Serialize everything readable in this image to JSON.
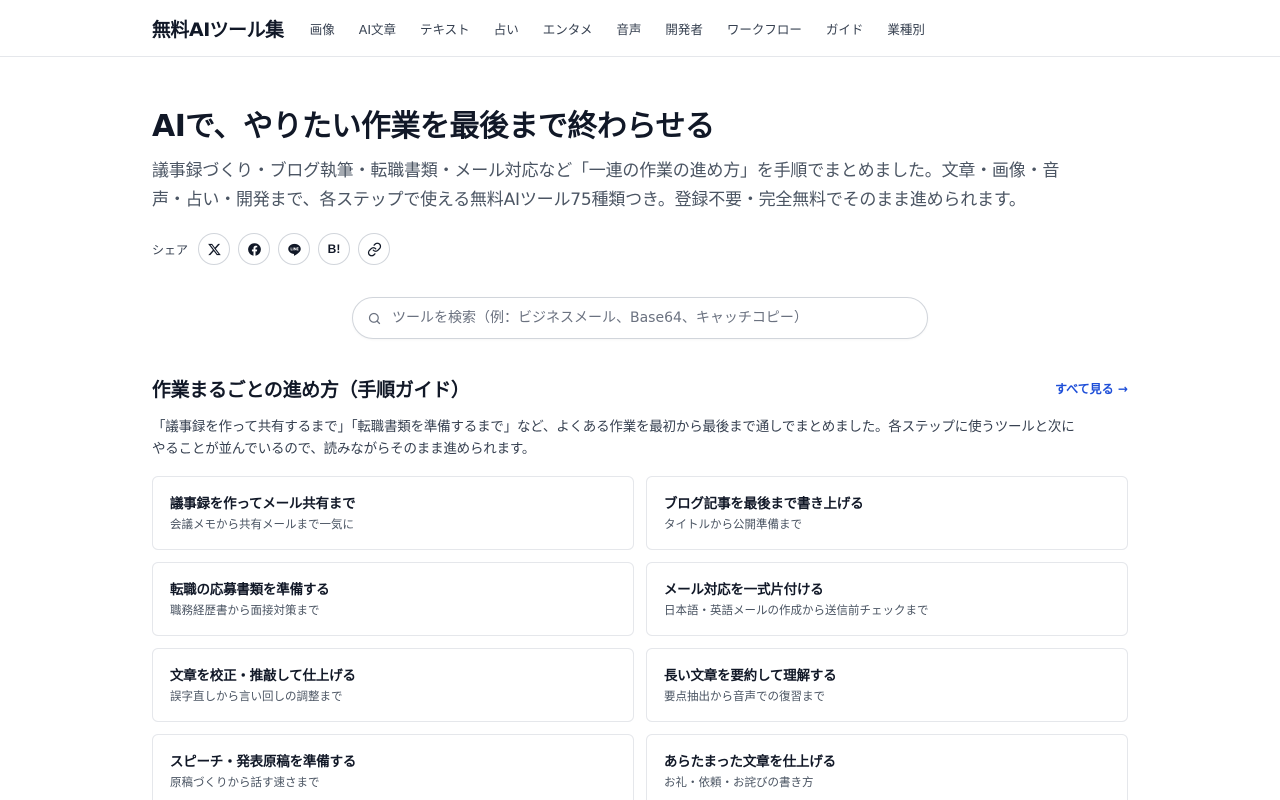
{
  "header": {
    "logo": "無料AIツール集",
    "nav": [
      "画像",
      "AI文章",
      "テキスト",
      "占い",
      "エンタメ",
      "音声",
      "開発者",
      "ワークフロー",
      "ガイド",
      "業種別"
    ]
  },
  "hero": {
    "title": "AIで、やりたい作業を最後まで終わらせる",
    "description_line1": "議事録づくり・ブログ執筆・転職書類・メール対応など「一連の作業の進め方」を手順でまとめました。文章・画像・音",
    "description_line2": "声・占い・開発まで、各ステップで使える無料AIツール75種類つき。登録不要・完全無料でそのまま進められます。"
  },
  "share": {
    "label": "シェア",
    "buttons": [
      {
        "icon": "x-icon"
      },
      {
        "icon": "facebook-icon"
      },
      {
        "icon": "line-icon"
      },
      {
        "icon": "hatena-icon",
        "text": "B!"
      },
      {
        "icon": "link-icon"
      }
    ]
  },
  "search": {
    "placeholder": "ツールを検索（例：ビジネスメール、Base64、キャッチコピー）",
    "icon": "search-icon"
  },
  "section": {
    "title": "作業まるごとの進め方（手順ガイド）",
    "see_all": "すべて見る →",
    "description_line1": "「議事録を作って共有するまで」「転職書類を準備するまで」など、よくある作業を最初から最後まで通しでまとめました。各ステップに使うツールと次に",
    "description_line2": "やることが並んでいるので、読みながらそのまま進められます。",
    "cards": [
      {
        "title": "議事録を作ってメール共有まで",
        "subtitle": "会議メモから共有メールまで一気に"
      },
      {
        "title": "ブログ記事を最後まで書き上げる",
        "subtitle": "タイトルから公開準備まで"
      },
      {
        "title": "転職の応募書類を準備する",
        "subtitle": "職務経歴書から面接対策まで"
      },
      {
        "title": "メール対応を一式片付ける",
        "subtitle": "日本語・英語メールの作成から送信前チェックまで"
      },
      {
        "title": "文章を校正・推敲して仕上げる",
        "subtitle": "誤字直しから言い回しの調整まで"
      },
      {
        "title": "長い文章を要約して理解する",
        "subtitle": "要点抽出から音声での復習まで"
      },
      {
        "title": "スピーチ・発表原稿を準備する",
        "subtitle": "原稿づくりから話す速さまで"
      },
      {
        "title": "あらたまった文章を仕上げる",
        "subtitle": "お礼・依頼・お詫びの書き方"
      }
    ]
  }
}
